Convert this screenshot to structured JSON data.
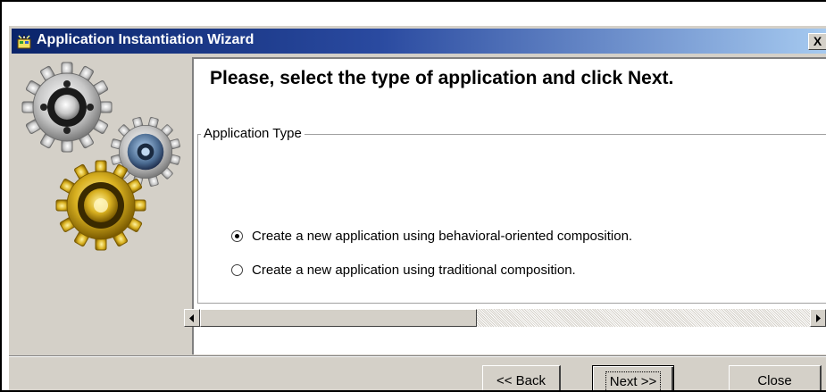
{
  "window": {
    "title": "Application Instantiation Wizard",
    "close_symbol": "X"
  },
  "icons": {
    "title_icon": "wizard-app-icon",
    "illustration": "gears-illustration",
    "scroll_left": "scroll-left-arrow-icon",
    "scroll_right": "scroll-right-arrow-icon"
  },
  "content": {
    "heading": "Please, select the type of application and click Next.",
    "group_label": "Application Type",
    "options": [
      {
        "label": "Create a new application using behavioral-oriented composition.",
        "selected": true
      },
      {
        "label": "Create a new application using traditional composition.",
        "selected": false
      }
    ]
  },
  "buttons": {
    "back": "<< Back",
    "next": "Next >>",
    "close": "Close"
  },
  "colors": {
    "titlebar_start": "#0a246a",
    "titlebar_end": "#a6caf0",
    "face": "#d4d0c8"
  }
}
